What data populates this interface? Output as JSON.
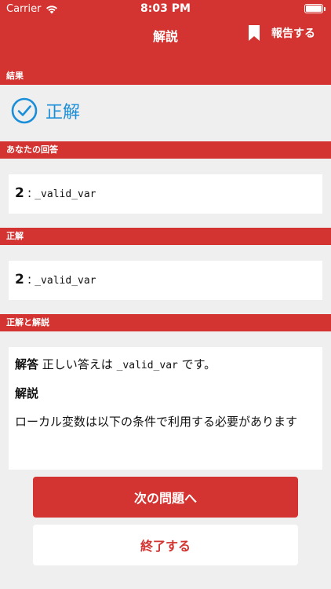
{
  "status": {
    "carrier": "Carrier",
    "time": "8:03 PM"
  },
  "nav": {
    "title": "解説",
    "report_label": "報告する"
  },
  "sections": {
    "result": "結果",
    "your_answer": "あなたの回答",
    "correct": "正解",
    "correct_and_explanation": "正解と解説"
  },
  "result": {
    "text": "正解"
  },
  "your_answer": {
    "number": "2",
    "separator": ":",
    "code": "_valid_var"
  },
  "correct_answer": {
    "number": "2",
    "separator": ":",
    "code": "_valid_var"
  },
  "explanation": {
    "answer_label": "解答",
    "answer_prefix": "正しい答えは",
    "answer_code": "_valid_var",
    "answer_suffix": "です。",
    "explain_label": "解説",
    "body": "ローカル変数は以下の条件で利用する必要があります"
  },
  "buttons": {
    "next": "次の問題へ",
    "finish": "終了する"
  },
  "colors": {
    "accent": "#d33431",
    "correct": "#1a8ed8",
    "background": "#efefef"
  }
}
